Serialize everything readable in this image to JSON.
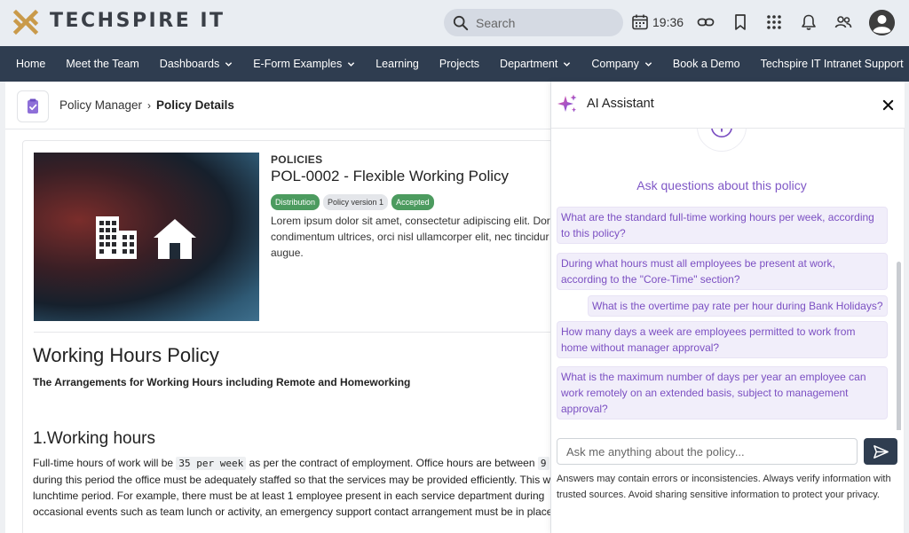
{
  "header": {
    "brand": "TECHSPIRE IT",
    "search_placeholder": "Search",
    "clock": "19:36"
  },
  "nav": {
    "items": [
      {
        "label": "Home",
        "dropdown": false
      },
      {
        "label": "Meet the Team",
        "dropdown": false
      },
      {
        "label": "Dashboards",
        "dropdown": true
      },
      {
        "label": "E-Form Examples",
        "dropdown": true
      },
      {
        "label": "Learning",
        "dropdown": false
      },
      {
        "label": "Projects",
        "dropdown": false
      },
      {
        "label": "Department",
        "dropdown": true
      },
      {
        "label": "Company",
        "dropdown": true
      },
      {
        "label": "Book a Demo",
        "dropdown": false
      },
      {
        "label": "Techspire IT Intranet Support",
        "dropdown": false
      }
    ]
  },
  "breadcrumb": {
    "parent": "Policy Manager",
    "separator": "›",
    "current": "Policy Details"
  },
  "policy": {
    "category": "POLICIES",
    "title": "POL-0002 - Flexible Working Policy",
    "badges": [
      {
        "label": "Distribution",
        "style": "green"
      },
      {
        "label": "Policy version 1",
        "style": "grey"
      },
      {
        "label": "Accepted",
        "style": "green"
      }
    ],
    "summary_lines": [
      "Lorem ipsum dolor sit amet, consectetur adipiscing elit. Dor",
      "condimentum ultrices, orci nisl ullamcorper elit, nec tincidur",
      "augue."
    ],
    "heading": "Working Hours Policy",
    "subheading": "The Arrangements for Working Hours including Remote and Homeworking",
    "section_title": "1.Working hours",
    "para": {
      "l1_pre": "Full-time hours of work will be ",
      "l1_code": "35 per week",
      "l1_mid": " as per the contract of employment. Office hours are between ",
      "l1_code2": "9",
      "l2": "during this period the office must be adequately staffed so that the services may be provided efficiently. This w",
      "l3": "lunchtime period.  For example, there must be at least 1 employee present in each service department during",
      "l4": "occasional events such as team lunch or activity, an emergency support contact arrangement must be in place"
    }
  },
  "ai": {
    "title": "AI Assistant",
    "heading": "Ask questions about this policy",
    "questions": [
      {
        "lines": [
          "What are the standard full-time working hours per week, according",
          "to this policy?"
        ]
      },
      {
        "lines": [
          "During what hours must all employees be present at work,",
          "according to the \"Core-Time\" section?"
        ]
      },
      {
        "lines": [
          "What is the overtime pay rate per hour during Bank Holidays?"
        ]
      },
      {
        "lines": [
          "How many days a week are employees permitted to work from",
          "home without manager approval?"
        ]
      },
      {
        "lines": [
          "What is the maximum number of days per year an employee can",
          "work remotely on an extended basis, subject to management",
          "approval?"
        ]
      }
    ],
    "input_placeholder": "Ask me anything about the policy...",
    "disclaimer": "Answers may contain errors or inconsistencies. Always verify information with trusted sources. Avoid sharing sensitive information to protect your privacy."
  },
  "colors": {
    "nav_bg": "#2f3d50",
    "accent_purple": "#7b4fc2",
    "badge_green": "#4c9b5f",
    "logo_gold": "#c99a4a"
  }
}
